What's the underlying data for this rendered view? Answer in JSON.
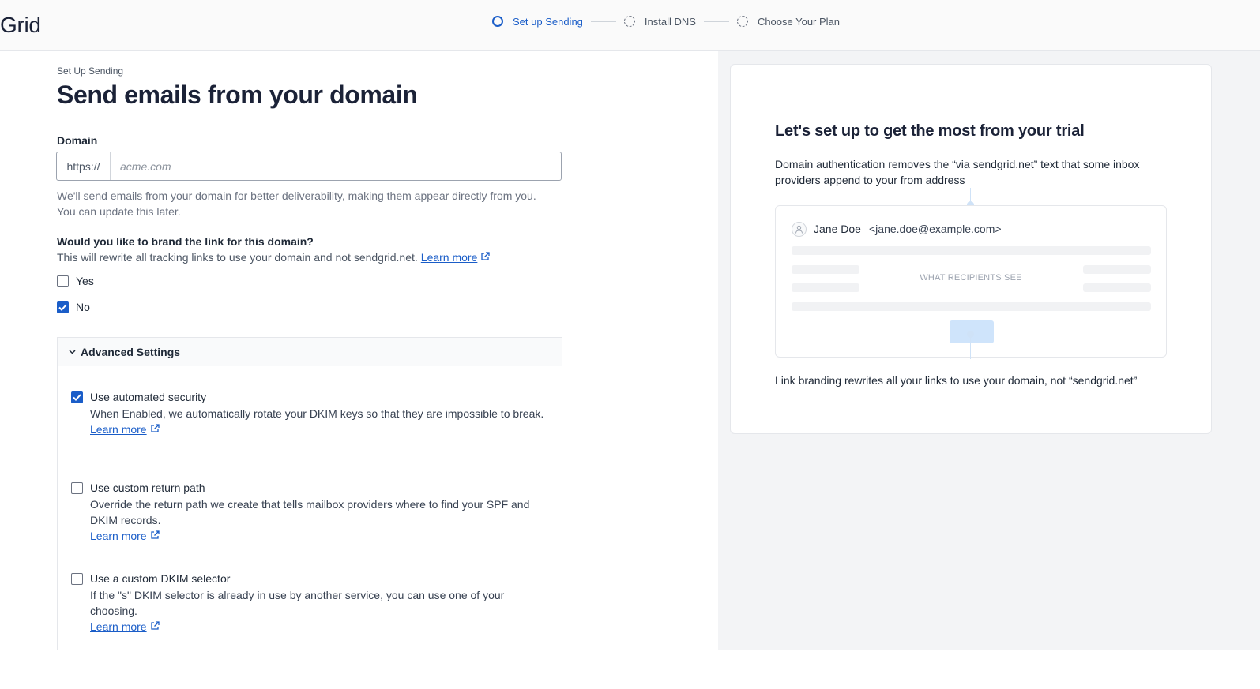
{
  "app": {
    "logo_text": "Grid"
  },
  "stepper": [
    {
      "label": "Set up Sending",
      "state": "active"
    },
    {
      "label": "Install DNS",
      "state": "pending"
    },
    {
      "label": "Choose Your Plan",
      "state": "pending"
    }
  ],
  "form": {
    "eyebrow": "Set Up Sending",
    "title": "Send emails from your domain",
    "domain_label": "Domain",
    "domain_prefix": "https://",
    "domain_placeholder": "acme.com",
    "domain_value": "",
    "domain_help": "We'll send emails from your domain for better deliverability, making them appear directly from you. You can update this later.",
    "brand_question": "Would you like to brand the link for this domain?",
    "brand_subtext": "This will rewrite all tracking links to use your domain and not sendgrid.net.",
    "brand_learn_more": "Learn more",
    "options": [
      {
        "label": "Yes",
        "checked": false
      },
      {
        "label": "No",
        "checked": true
      }
    ]
  },
  "advanced": {
    "title": "Advanced Settings",
    "expanded": true,
    "settings": [
      {
        "label": "Use automated security",
        "checked": true,
        "description": "When Enabled, we automatically rotate your DKIM keys so that they are impossible to break.",
        "learn_more": "Learn more"
      },
      {
        "label": "Use custom return path",
        "checked": false,
        "description": "Override the return path we create that tells mailbox providers where to find your SPF and DKIM records.",
        "learn_more": "Learn more"
      },
      {
        "label": "Use a custom DKIM selector",
        "checked": false,
        "description": "If the \"s\" DKIM selector is already in use by another service, you can use one of your choosing.",
        "learn_more": "Learn more"
      }
    ]
  },
  "side_card": {
    "title": "Let's set up to get the most from your trial",
    "description": "Domain authentication removes the “via sendgrid.net” text that some inbox providers append to your from address",
    "preview": {
      "sender_name": "Jane Doe",
      "sender_email": "<jane.doe@example.com>",
      "caption": "WHAT RECIPIENTS SEE"
    },
    "footer": "Link branding rewrites all your links to use your domain, not “sendgrid.net”"
  },
  "colors": {
    "accent": "#1a5dc8",
    "preview_highlight": "#cfe4fb"
  }
}
